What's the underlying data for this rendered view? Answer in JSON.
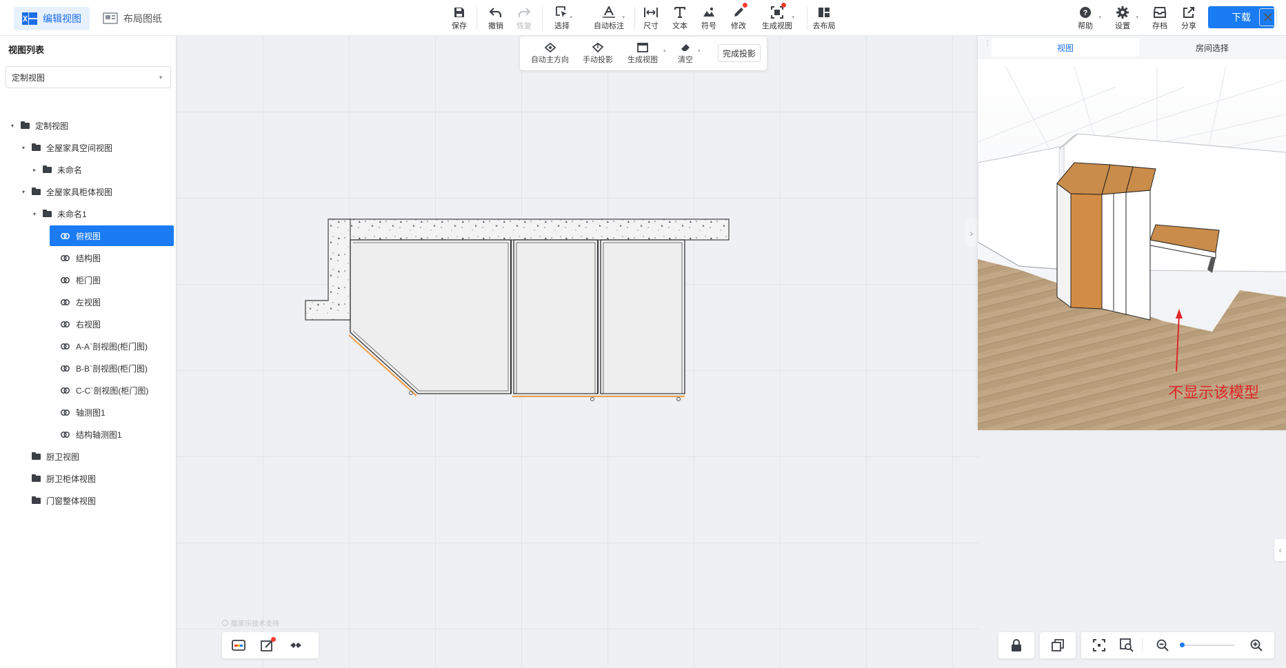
{
  "modes": {
    "edit_view": "编辑视图",
    "layout_sheet": "布局图纸"
  },
  "toolbar": {
    "save": "保存",
    "undo": "撤销",
    "redo": "恢复",
    "select": "选择",
    "auto_dim": "自动标注",
    "dimension": "尺寸",
    "text": "文本",
    "symbol": "符号",
    "modify": "修改",
    "generate_view": "生成视图",
    "go_layout": "去布局",
    "help": "帮助",
    "settings": "设置",
    "archive": "存档",
    "share": "分享",
    "download": "下载"
  },
  "subtoolbar": {
    "auto_direction": "自动主方向",
    "manual_projection": "手动投影",
    "generate_view": "生成视图",
    "clear": "清空",
    "finish_projection": "完成投影"
  },
  "left_panel": {
    "title": "视图列表",
    "select_value": "定制视图",
    "tree": [
      {
        "label": "定制视图",
        "type": "folder",
        "level": 0,
        "expanded": true
      },
      {
        "label": "全屋家具空间视图",
        "type": "folder",
        "level": 1,
        "expanded": true
      },
      {
        "label": "未命名",
        "type": "folder",
        "level": 2,
        "expanded": false
      },
      {
        "label": "全屋家具柜体视图",
        "type": "folder",
        "level": 1,
        "expanded": true
      },
      {
        "label": "未命名1",
        "type": "folder",
        "level": 2,
        "expanded": true
      },
      {
        "label": "俯视图",
        "type": "view",
        "level": 3,
        "selected": true
      },
      {
        "label": "结构图",
        "type": "view",
        "level": 3
      },
      {
        "label": "柜门图",
        "type": "view",
        "level": 3
      },
      {
        "label": "左视图",
        "type": "view",
        "level": 3
      },
      {
        "label": "右视图",
        "type": "view",
        "level": 3
      },
      {
        "label": "A-A`剖视图(柜门图)",
        "type": "view",
        "level": 3
      },
      {
        "label": "B-B`剖视图(柜门图)",
        "type": "view",
        "level": 3
      },
      {
        "label": "C-C`剖视图(柜门图)",
        "type": "view",
        "level": 3
      },
      {
        "label": "轴测图1",
        "type": "view",
        "level": 3
      },
      {
        "label": "结构轴测图1",
        "type": "view",
        "level": 3
      },
      {
        "label": "厨卫视图",
        "type": "folder",
        "level": 1
      },
      {
        "label": "厨卫柜体视图",
        "type": "folder",
        "level": 1
      },
      {
        "label": "门窗整体视图",
        "type": "folder",
        "level": 1
      }
    ]
  },
  "canvas": {
    "credit": "酷家乐技术支持"
  },
  "right_panel": {
    "tabs": [
      "视图",
      "房间选择"
    ],
    "annotation": "不显示该模型"
  },
  "colors": {
    "accent": "#1a7bf2",
    "annotation_red": "#e0262b",
    "edge_orange": "#f0a050"
  }
}
